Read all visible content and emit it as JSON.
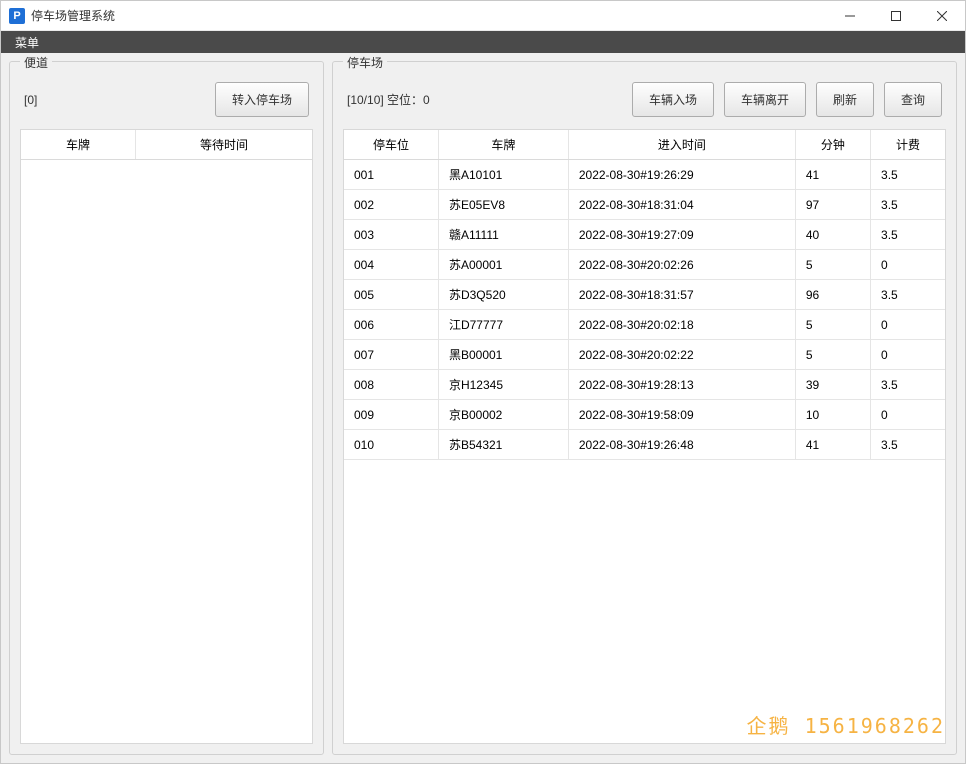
{
  "window": {
    "title": "停车场管理系统",
    "icon_letter": "P"
  },
  "menubar": {
    "menu_label": "菜单"
  },
  "lane": {
    "title": "便道",
    "count_label": "[0]",
    "move_in_label": "转入停车场",
    "columns": [
      "车牌",
      "等待时间"
    ],
    "rows": []
  },
  "parking": {
    "title": "停车场",
    "status": "[10/10]   空位：0",
    "buttons": {
      "enter": "车辆入场",
      "leave": "车辆离开",
      "refresh": "刷新",
      "query": "查询"
    },
    "columns": [
      "停车位",
      "车牌",
      "进入时间",
      "分钟",
      "计费"
    ],
    "rows": [
      {
        "slot": "001",
        "plate": "黑A10101",
        "time": "2022-08-30#19:26:29",
        "minutes": "41",
        "fee": "3.5"
      },
      {
        "slot": "002",
        "plate": "苏E05EV8",
        "time": "2022-08-30#18:31:04",
        "minutes": "97",
        "fee": "3.5"
      },
      {
        "slot": "003",
        "plate": "赣A11111",
        "time": "2022-08-30#19:27:09",
        "minutes": "40",
        "fee": "3.5"
      },
      {
        "slot": "004",
        "plate": "苏A00001",
        "time": "2022-08-30#20:02:26",
        "minutes": "5",
        "fee": "0"
      },
      {
        "slot": "005",
        "plate": "苏D3Q520",
        "time": "2022-08-30#18:31:57",
        "minutes": "96",
        "fee": "3.5"
      },
      {
        "slot": "006",
        "plate": "江D77777",
        "time": "2022-08-30#20:02:18",
        "minutes": "5",
        "fee": "0"
      },
      {
        "slot": "007",
        "plate": "黑B00001",
        "time": "2022-08-30#20:02:22",
        "minutes": "5",
        "fee": "0"
      },
      {
        "slot": "008",
        "plate": "京H12345",
        "time": "2022-08-30#19:28:13",
        "minutes": "39",
        "fee": "3.5"
      },
      {
        "slot": "009",
        "plate": "京B00002",
        "time": "2022-08-30#19:58:09",
        "minutes": "10",
        "fee": "0"
      },
      {
        "slot": "010",
        "plate": "苏B54321",
        "time": "2022-08-30#19:26:48",
        "minutes": "41",
        "fee": "3.5"
      }
    ]
  },
  "watermark": "企鹅 1561968262"
}
